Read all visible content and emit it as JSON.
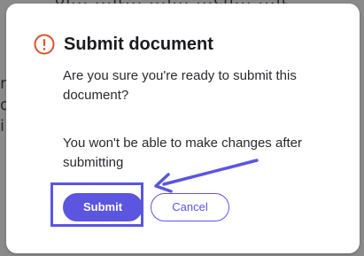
{
  "background": {
    "top_text": "of...  ...it...  ...f...  ...ch...  ...it",
    "left_letters": [
      "r",
      "d",
      "i"
    ]
  },
  "dialog": {
    "title": "Submit document",
    "icon": "alert-circle-icon",
    "message": "Are you sure you're ready to submit this document?",
    "warning": "You won't be able to make changes after submitting",
    "submit_label": "Submit",
    "cancel_label": "Cancel"
  },
  "annotation": {
    "highlight_color": "#5b55e0",
    "arrow_color": "#5b55e0",
    "target": "submit-button"
  },
  "colors": {
    "accent": "#5b55e0",
    "alert_icon": "#d9532b",
    "overlay": "#8a8a8a"
  }
}
